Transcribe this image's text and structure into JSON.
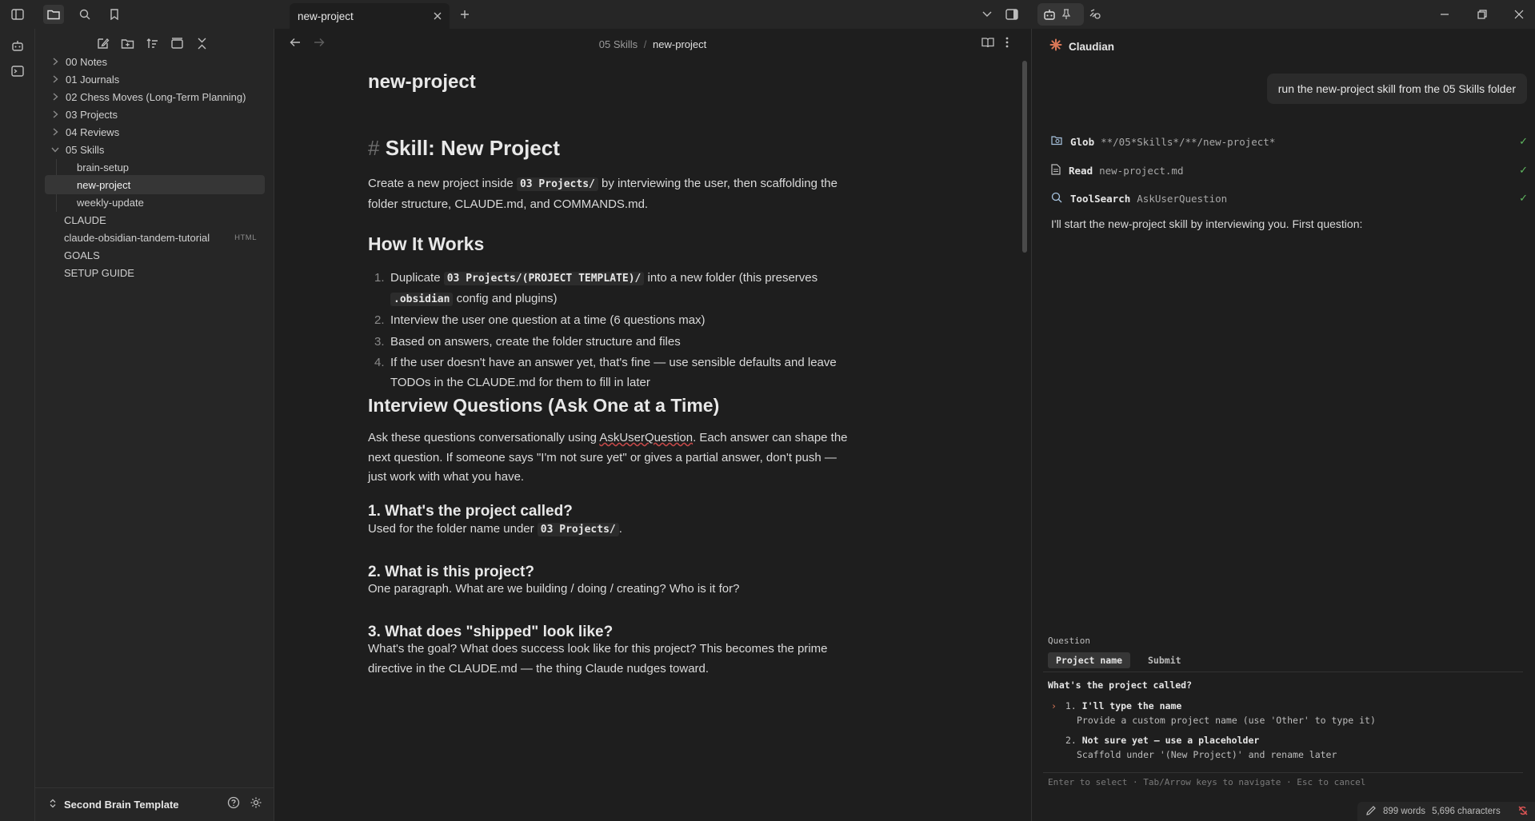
{
  "window": {
    "tab_title": "new-project"
  },
  "file_tree": {
    "items": [
      {
        "label": "00 Notes"
      },
      {
        "label": "01 Journals"
      },
      {
        "label": "02 Chess Moves (Long-Term Planning)"
      },
      {
        "label": "03 Projects"
      },
      {
        "label": "04 Reviews"
      },
      {
        "label": "05 Skills"
      },
      {
        "label": "brain-setup"
      },
      {
        "label": "new-project"
      },
      {
        "label": "weekly-update"
      },
      {
        "label": "CLAUDE"
      },
      {
        "label": "claude-obsidian-tandem-tutorial",
        "badge": "HTML"
      },
      {
        "label": "GOALS"
      },
      {
        "label": "SETUP GUIDE"
      }
    ],
    "vault_name": "Second Brain Template"
  },
  "editor": {
    "breadcrumb_folder": "05 Skills",
    "breadcrumb_sep": "/",
    "breadcrumb_file": "new-project",
    "inline_title": "new-project",
    "h1_marker": "#",
    "h1": "Skill: New Project",
    "intro_1": "Create a new project inside",
    "intro_code": "03 Projects/",
    "intro_2": "by interviewing the user, then scaffolding the folder structure, CLAUDE.md, and COMMANDS.md.",
    "h2_how": "How It Works",
    "steps": [
      {
        "num": "1.",
        "pre": "Duplicate",
        "code1": "03 Projects/(PROJECT TEMPLATE)/",
        "mid": "into a new folder (this preserves",
        "code2": ".obsidian",
        "post": "config and plugins)"
      },
      {
        "num": "2.",
        "text": "Interview the user one question at a time (6 questions max)"
      },
      {
        "num": "3.",
        "text": "Based on answers, create the folder structure and files"
      },
      {
        "num": "4.",
        "text": "If the user doesn't have an answer yet, that's fine — use sensible defaults and leave TODOs in the CLAUDE.md for them to fill in later"
      }
    ],
    "h2_interview": "Interview Questions (Ask One at a Time)",
    "interview_1": "Ask these questions conversationally using",
    "interview_link": "AskUserQuestion",
    "interview_2": ". Each answer can shape the next question. If someone says \"I'm not sure yet\" or gives a partial answer, don't push — just work with what you have.",
    "q1_title": "1. What's the project called?",
    "q1_text": "Used for the folder name under",
    "q1_code": "03 Projects/",
    "q1_end": ".",
    "q2_title": "2. What is this project?",
    "q2_text": "One paragraph. What are we building / doing / creating? Who is it for?",
    "q3_title": "3. What does \"shipped\" look like?",
    "q3_text": "What's the goal? What does success look like for this project? This becomes the prime directive in the CLAUDE.md — the thing Claude nudges toward."
  },
  "assistant": {
    "name": "Claudian",
    "user_message": "run the new-project skill from the 05 Skills folder",
    "tools": [
      {
        "name": "Glob",
        "arg": "**/05*Skills*/**/new-project*",
        "icon": "folder-search-icon"
      },
      {
        "name": "Read",
        "arg": "new-project.md",
        "icon": "file-icon"
      },
      {
        "name": "ToolSearch",
        "arg": "AskUserQuestion",
        "icon": "search-icon"
      }
    ],
    "check_glyph": "✓",
    "reply": "I'll start the new-project skill by interviewing you. First question:",
    "question_label": "Question",
    "tabs": [
      "Project name",
      "Submit"
    ],
    "question": "What's the project called?",
    "options": [
      {
        "pointer": "›",
        "num": "1.",
        "title": "I'll type the name",
        "desc": "Provide a custom project name (use 'Other' to type it)"
      },
      {
        "pointer": "",
        "num": "2.",
        "title": "Not sure yet — use a placeholder",
        "desc": "Scaffold under '(New Project)' and rename later"
      }
    ],
    "hint": "Enter to select · Tab/Arrow keys to navigate · Esc to cancel"
  },
  "status": {
    "words": "899 words",
    "chars": "5,696 characters"
  },
  "colors": {
    "accent": "#d97757",
    "success": "#5fb860",
    "background": "#1e1e1e",
    "sidebar": "#262626"
  }
}
